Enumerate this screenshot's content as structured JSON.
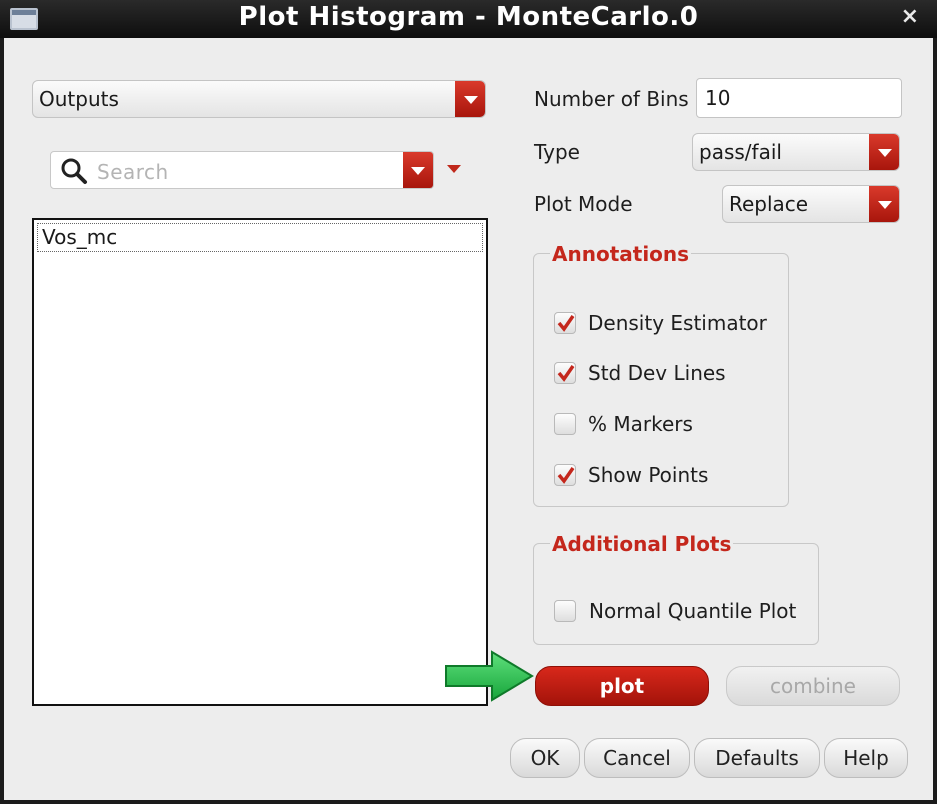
{
  "window": {
    "title": "Plot Histogram - MonteCarlo.0",
    "close_label": "×"
  },
  "left": {
    "category_select": "Outputs",
    "search_placeholder": "Search",
    "list_items": [
      "Vos_mc"
    ]
  },
  "settings": {
    "bins_label": "Number of Bins",
    "bins_value": "10",
    "type_label": "Type",
    "type_value": "pass/fail",
    "plot_mode_label": "Plot Mode",
    "plot_mode_value": "Replace"
  },
  "annotations": {
    "title": "Annotations",
    "items": [
      {
        "label": "Density Estimator",
        "checked": true
      },
      {
        "label": "Std Dev Lines",
        "checked": true
      },
      {
        "label": "% Markers",
        "checked": false
      },
      {
        "label": "Show Points",
        "checked": true
      }
    ]
  },
  "additional_plots": {
    "title": "Additional Plots",
    "items": [
      {
        "label": "Normal Quantile Plot",
        "checked": false
      }
    ]
  },
  "actions": {
    "plot_label": "plot",
    "combine_label": "combine",
    "ok_label": "OK",
    "cancel_label": "Cancel",
    "defaults_label": "Defaults",
    "help_label": "Help"
  },
  "colors": {
    "accent_red": "#c4271c",
    "pointer_arrow_green": "#1fbe4a"
  }
}
